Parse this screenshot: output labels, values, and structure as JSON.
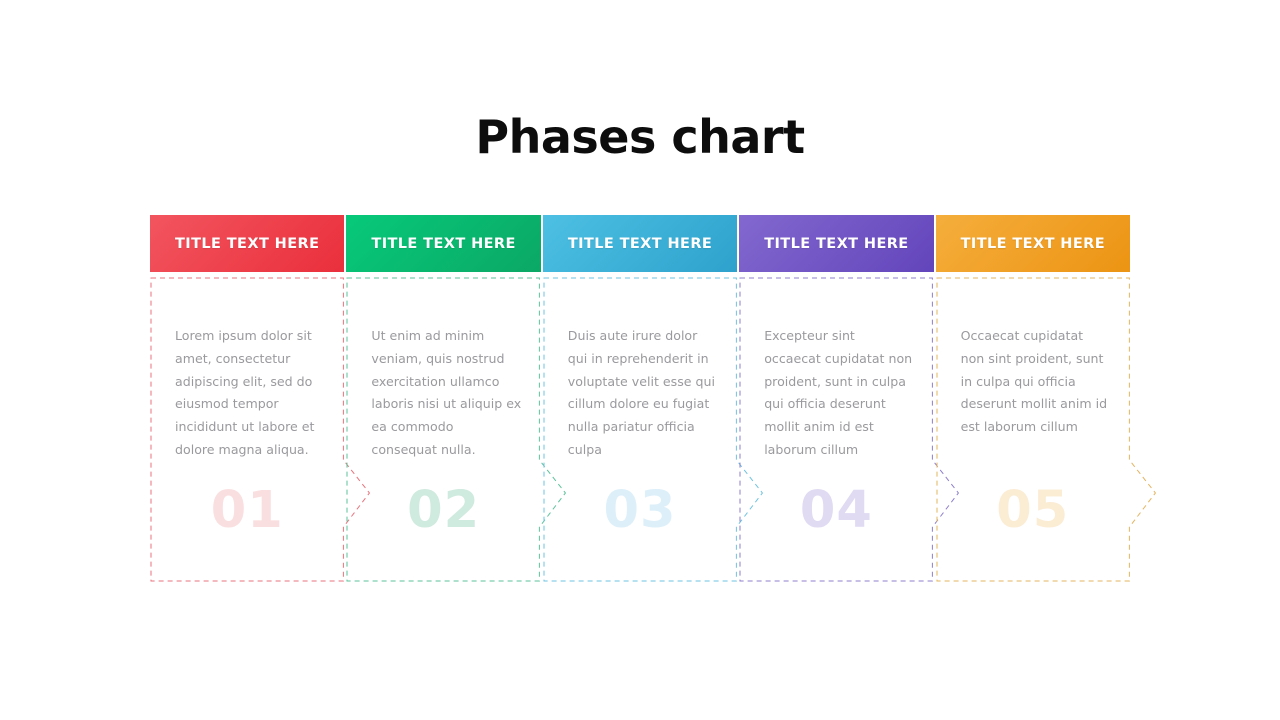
{
  "page": {
    "title": "Phases chart",
    "background": "#ffffff"
  },
  "chart_data": {
    "type": "diagram",
    "subtype": "phases-chevron",
    "title": "Phases chart",
    "phase_count": 5,
    "phases": [
      {
        "number": "01",
        "header": "TITLE TEXT HERE",
        "body": "Lorem ipsum dolor sit amet, consectetur adipiscing elit, sed do eiusmod tempor incididunt ut labore et dolore magna aliqua.",
        "color": "#ef404a",
        "gradient_from": "#f2555f",
        "gradient_to": "#ea2f3c",
        "dash_color": "#e8737c",
        "number_color": "#fadfe0"
      },
      {
        "number": "02",
        "header": "TITLE TEXT HERE",
        "body": "Ut enim ad minim veniam, quis nostrud exercitation ullamco laboris nisi ut aliquip ex ea commodo consequat nulla.",
        "color": "#09b96e",
        "gradient_from": "#07c97a",
        "gradient_to": "#0ba865",
        "dash_color": "#5cc39b",
        "number_color": "#cfeade"
      },
      {
        "number": "03",
        "header": "TITLE TEXT HERE",
        "body": "Duis aute irure dolor qui in reprehenderit in voluptate velit esse qui cillum dolore eu fugiat nulla pariatur officia culpa",
        "color": "#3fb3dd",
        "gradient_from": "#4dc0e3",
        "gradient_to": "#2ea2cc",
        "dash_color": "#6ec3e0",
        "number_color": "#ddeff9"
      },
      {
        "number": "04",
        "header": "TITLE TEXT HERE",
        "body": "Excepteur sint occaecat cupidatat non proident, sunt in culpa qui officia deserunt mollit anim id est laborum cillum",
        "color": "#7158c6",
        "gradient_from": "#8268cf",
        "gradient_to": "#6345bb",
        "dash_color": "#8f7fcb",
        "number_color": "#e0daf2"
      },
      {
        "number": "05",
        "header": "TITLE TEXT HERE",
        "body": "Occaecat cupidatat non sint  proident, sunt in culpa qui officia deserunt mollit anim id est laborum cillum",
        "color": "#f0a026",
        "gradient_from": "#f5ae3c",
        "gradient_to": "#ec9413",
        "dash_color": "#e5b460",
        "number_color": "#fbecd4"
      }
    ]
  }
}
